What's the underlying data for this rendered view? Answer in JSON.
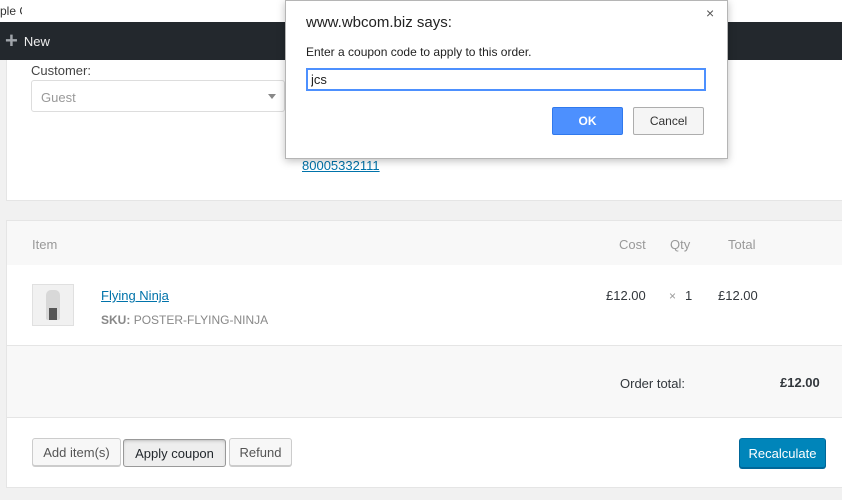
{
  "browser": {
    "tab_title": "ple Gr"
  },
  "admin_bar": {
    "new_label": "New",
    "new_icon": "plus-icon"
  },
  "order": {
    "customer_label": "Customer:",
    "customer_value": "Guest",
    "phone": "80005332111"
  },
  "items_table": {
    "headers": {
      "item": "Item",
      "cost": "Cost",
      "qty": "Qty",
      "total": "Total"
    },
    "rows": [
      {
        "name": "Flying Ninja",
        "sku_label": "SKU:",
        "sku": "POSTER-FLYING-NINJA",
        "cost": "£12.00",
        "qty_sign": "×",
        "qty": "1",
        "total": "£12.00"
      }
    ],
    "order_total_label": "Order total:",
    "order_total_value": "£12.00"
  },
  "actions": {
    "add_items": "Add item(s)",
    "apply_coupon": "Apply coupon",
    "refund": "Refund",
    "recalculate": "Recalculate"
  },
  "dialog": {
    "title": "www.wbcom.biz says:",
    "message": "Enter a coupon code to apply to this order.",
    "input_value": "jcs",
    "ok_label": "OK",
    "cancel_label": "Cancel",
    "close_glyph": "×"
  },
  "colors": {
    "primary_button": "#0085ba",
    "link": "#0073aa",
    "admin_bar": "#23282d",
    "dialog_ok": "#4d90fe"
  }
}
